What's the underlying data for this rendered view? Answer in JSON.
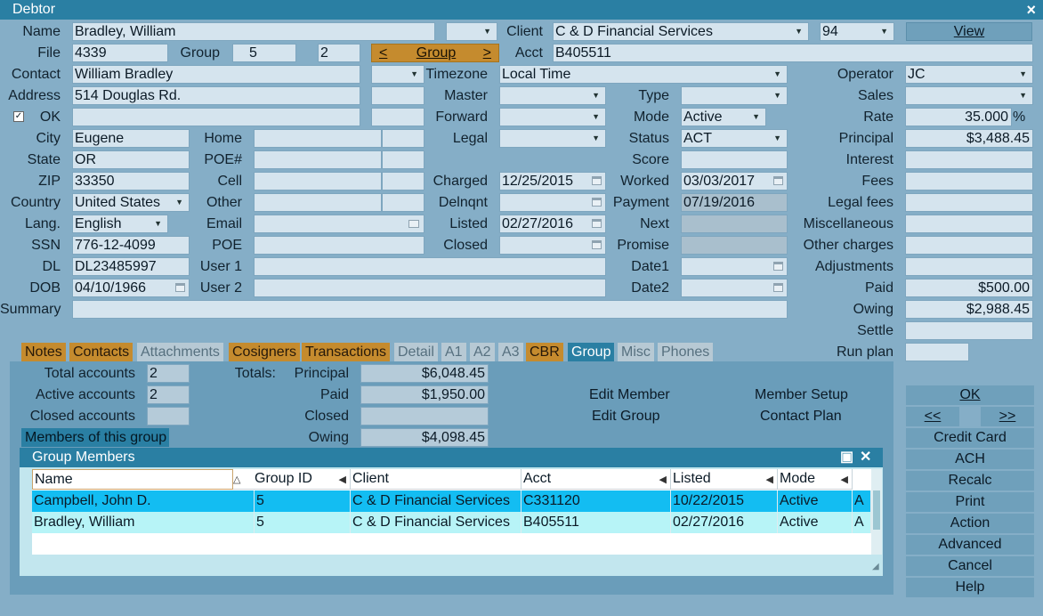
{
  "window": {
    "title": "Debtor",
    "close_glyph": "×"
  },
  "labels": {
    "name": "Name",
    "file": "File",
    "group": "Group",
    "contact": "Contact",
    "address": "Address",
    "ok": "OK",
    "city": "City",
    "state": "State",
    "zip": "ZIP",
    "country": "Country",
    "lang": "Lang.",
    "ssn": "SSN",
    "dl": "DL",
    "dob": "DOB",
    "summary": "Summary",
    "home": "Home",
    "poe_num": "POE#",
    "cell": "Cell",
    "other": "Other",
    "email": "Email",
    "poe": "POE",
    "user1": "User 1",
    "user2": "User 2",
    "client": "Client",
    "acct": "Acct",
    "timezone": "Timezone",
    "master": "Master",
    "forward": "Forward",
    "legal": "Legal",
    "charged": "Charged",
    "delnqnt": "Delnqnt",
    "listed": "Listed",
    "closed": "Closed",
    "type": "Type",
    "mode": "Mode",
    "status": "Status",
    "score": "Score",
    "worked": "Worked",
    "payment": "Payment",
    "next": "Next",
    "promise": "Promise",
    "date1": "Date1",
    "date2": "Date2",
    "operator": "Operator",
    "sales": "Sales",
    "rate": "Rate",
    "principal": "Principal",
    "interest": "Interest",
    "fees": "Fees",
    "legal_fees": "Legal fees",
    "misc": "Miscellaneous",
    "other_charges": "Other charges",
    "adjustments": "Adjustments",
    "paid": "Paid",
    "owing": "Owing",
    "settle": "Settle",
    "run_plan": "Run plan"
  },
  "values": {
    "name": "Bradley, William",
    "client": "C & D Financial Services",
    "client_code": "94",
    "view": "View",
    "file": "4339",
    "group": "5",
    "group2": "2",
    "group_btn_prev": "<",
    "group_btn": "Group",
    "group_btn_next": ">",
    "acct": "B405511",
    "contact": "William Bradley",
    "timezone": "Local Time",
    "operator": "JC",
    "address": "514 Douglas Rd.",
    "mode": "Active",
    "rate": "35.000",
    "rate_unit": "%",
    "city": "Eugene",
    "status": "ACT",
    "principal": "$3,488.45",
    "state": "OR",
    "zip": "33350",
    "charged": "12/25/2015",
    "worked": "03/03/2017",
    "country": "United States",
    "payment": "07/19/2016",
    "lang": "English",
    "listed": "02/27/2016",
    "ssn": "776-12-4099",
    "dl": "DL23485997",
    "dob": "04/10/1966",
    "paid": "$500.00",
    "owing": "$2,988.45"
  },
  "tabs": [
    "Notes",
    "Contacts",
    "Attachments",
    "Cosigners",
    "Transactions",
    "Detail",
    "A1",
    "A2",
    "A3",
    "CBR",
    "Group",
    "Misc",
    "Phones"
  ],
  "group_panel": {
    "total_accounts_label": "Total accounts",
    "total_accounts": "2",
    "active_accounts_label": "Active accounts",
    "active_accounts": "2",
    "closed_accounts_label": "Closed accounts",
    "closed_accounts": "",
    "members_btn": "Members of this group",
    "totals_label": "Totals:",
    "principal_label": "Principal",
    "principal": "$6,048.45",
    "paid_label": "Paid",
    "paid": "$1,950.00",
    "closed_label": "Closed",
    "closed": "",
    "owing_label": "Owing",
    "owing": "$4,098.45",
    "edit_member": "Edit Member",
    "edit_group": "Edit Group",
    "member_setup": "Member Setup",
    "contact_plan": "Contact Plan"
  },
  "group_members": {
    "title": "Group Members",
    "columns": [
      "Name",
      "Group ID",
      "Client",
      "Acct",
      "Listed",
      "Mode"
    ],
    "rows": [
      [
        "Campbell, John D.",
        "5",
        "C & D Financial Services",
        "C331120",
        "10/22/2015",
        "Active",
        "A"
      ],
      [
        "Bradley, William",
        "5",
        "C & D Financial Services",
        "B405511",
        "02/27/2016",
        "Active",
        "A"
      ]
    ]
  },
  "actions": {
    "ok": "OK",
    "prev": "<<",
    "next": ">>",
    "credit_card": "Credit Card",
    "ach": "ACH",
    "recalc": "Recalc",
    "print": "Print",
    "action": "Action",
    "advanced": "Advanced",
    "cancel": "Cancel",
    "help": "Help"
  },
  "colors": {
    "background": "#85aec7",
    "titlebar": "#2a7fa3",
    "accent_orange": "#c58b2e",
    "selected_row": "#13bdf2",
    "alt_row": "#b7f4f7"
  }
}
